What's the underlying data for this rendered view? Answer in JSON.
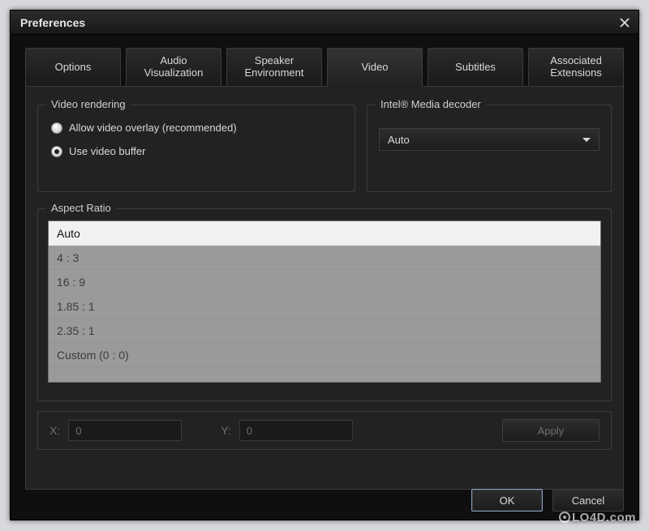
{
  "window": {
    "title": "Preferences"
  },
  "tabs": [
    {
      "label": "Options"
    },
    {
      "label": "Audio\nVisualization"
    },
    {
      "label": "Speaker\nEnvironment"
    },
    {
      "label": "Video"
    },
    {
      "label": "Subtitles"
    },
    {
      "label": "Associated\nExtensions"
    }
  ],
  "active_tab_index": 3,
  "video_rendering": {
    "legend": "Video rendering",
    "options": [
      {
        "label": "Allow video overlay (recommended)",
        "checked": false
      },
      {
        "label": "Use video buffer",
        "checked": true
      }
    ]
  },
  "media_decoder": {
    "legend": "Intel® Media decoder",
    "selected": "Auto"
  },
  "aspect_ratio": {
    "legend": "Aspect Ratio",
    "items": [
      "Auto",
      "4 : 3",
      "16 : 9",
      "1.85 : 1",
      "2.35 : 1",
      "Custom (0 : 0)"
    ],
    "selected_index": 0
  },
  "custom": {
    "x_label": "X:",
    "x_value": "0",
    "y_label": "Y:",
    "y_value": "0",
    "apply_label": "Apply"
  },
  "buttons": {
    "ok": "OK",
    "cancel": "Cancel"
  },
  "watermark": "LO4D.com"
}
